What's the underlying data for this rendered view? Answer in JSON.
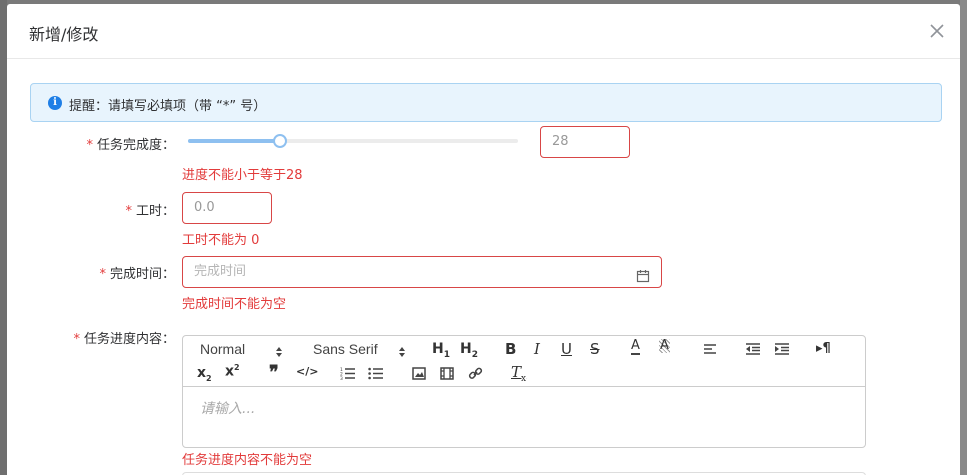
{
  "dialog": {
    "title": "新增/修改"
  },
  "alert": {
    "text": "提醒：请填写必填项（带 “*” 号）",
    "icon": "info-icon"
  },
  "form": {
    "required_mark": "*",
    "progress": {
      "label": "任务完成度：",
      "value": "28",
      "slider_percent": 28,
      "error": "进度不能小于等于28"
    },
    "hours": {
      "label": "工时：",
      "value": "0.0",
      "error": "工时不能为 0"
    },
    "finish_time": {
      "label": "完成时间：",
      "placeholder": "完成时间",
      "icon": "calendar-icon",
      "error": "完成时间不能为空"
    },
    "content": {
      "label": "任务进度内容：",
      "placeholder": "请输入...",
      "error": "任务进度内容不能为空",
      "toolbar": {
        "header_select": "Normal",
        "font_select": "Sans Serif",
        "buttons": [
          "h1-icon",
          "h2-icon",
          "bold-icon",
          "italic-icon",
          "underline-icon",
          "strike-icon",
          "font-color-icon",
          "background-color-icon",
          "align-icon",
          "outdent-icon",
          "indent-icon",
          "rtl-icon",
          "subscript-icon",
          "superscript-icon",
          "blockquote-icon",
          "code-block-icon",
          "ordered-list-icon",
          "bullet-list-icon",
          "image-icon",
          "video-icon",
          "link-icon",
          "clean-format-icon"
        ]
      }
    }
  },
  "colors": {
    "error": "#e23b3b",
    "accent": "#8ec0f0",
    "info": "#1f7fe6"
  }
}
